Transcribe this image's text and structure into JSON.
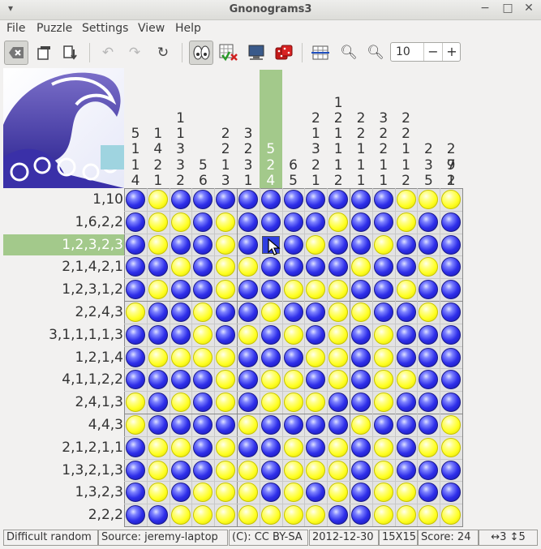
{
  "window": {
    "title": "Gnonograms3"
  },
  "menu": [
    "File",
    "Puzzle",
    "Settings",
    "View",
    "Help"
  ],
  "toolbar": {
    "zoom_value": "10",
    "zoom_minus": "−",
    "zoom_plus": "+"
  },
  "col_clues": [
    [
      "5",
      "1",
      "1",
      "4"
    ],
    [
      "1",
      "4",
      "2",
      "1"
    ],
    [
      "1",
      "1",
      "3",
      "3",
      "2"
    ],
    [
      "5",
      "6"
    ],
    [
      "2",
      "2",
      "1",
      "3"
    ],
    [
      "3",
      "2",
      "3",
      "1"
    ],
    [
      "5",
      "2",
      "4"
    ],
    [
      "6",
      "5"
    ],
    [
      "2",
      "1",
      "3",
      "2",
      "1"
    ],
    [
      "1",
      "2",
      "1",
      "1",
      "1",
      "2"
    ],
    [
      "2",
      "2",
      "1",
      "1",
      "1"
    ],
    [
      "3",
      "2",
      "2",
      "1",
      "1"
    ],
    [
      "2",
      "2",
      "1",
      "1",
      "2"
    ],
    [
      "2",
      "3",
      "5"
    ],
    [
      "2",
      "7",
      "2"
    ],
    [
      "9",
      "1"
    ]
  ],
  "highlighted_column": 6,
  "row_clues": [
    "1,10",
    "1,6,2,2",
    "1,2,3,2,3",
    "2,1,4,2,1",
    "1,2,3,1,2",
    "2,2,4,3",
    "3,1,1,1,1,3",
    "1,2,1,4",
    "4,1,1,2,2",
    "2,4,1,3",
    "4,4,3",
    "2,1,2,1,1",
    "1,3,2,1,3",
    "1,3,2,3",
    "2,2,2"
  ],
  "highlighted_row": 2,
  "grid": [
    "BYBBBBBBBBBBYYY",
    "BYYBYBBBBYBBYBB",
    "BYBBYBBBYBBYBBB",
    "BBYBYYBBBBYBBYB",
    "BYBBYBBYYYBBYBB",
    "YBBYBBYBBYYBBYB",
    "BBBYBYBYBYBYBBB",
    "BYYYYBBBYYBYBBB",
    "BBBBYBYYBYBYYBB",
    "YBYBYBYYYBBYBBB",
    "YBBBBYBBBBYBBBY",
    "BYYBYBBYBYBYBYY",
    "BYBBYYBYYYBYBBB",
    "BYBYYYBYBYBYYBB",
    "BBYYYYYYYBBYYYY"
  ],
  "status": {
    "difficulty": "Difficult random",
    "source": "Source: jeremy-laptop",
    "license": "(C): CC BY-SA",
    "date": "2012-12-30",
    "size": "15X15",
    "score": "Score: 24",
    "position": "↔3 ↕5"
  },
  "colors": {
    "blue": "#2f2fea",
    "yellow": "#ffff22",
    "highlight": "#a3c98b"
  }
}
